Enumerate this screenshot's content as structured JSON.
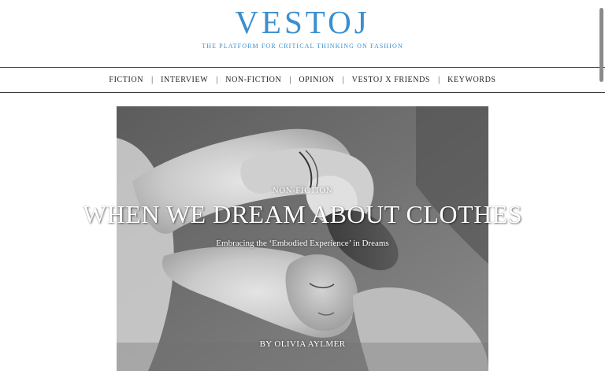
{
  "header": {
    "logo": "VESTOJ",
    "tagline": "THE PLATFORM FOR CRITICAL THINKING ON FASHION"
  },
  "nav": {
    "items": [
      {
        "label": "FICTION"
      },
      {
        "label": "INTERVIEW"
      },
      {
        "label": "NON-FICTION"
      },
      {
        "label": "OPINION"
      },
      {
        "label": "VESTOJ X FRIENDS"
      },
      {
        "label": "KEYWORDS"
      }
    ],
    "separator": "|"
  },
  "hero": {
    "kicker": "NON-FICTION",
    "title": "WHEN WE DREAM ABOUT CLOTHES",
    "subtitle": "Embracing the ‘Embodied Experience’ in Dreams",
    "byline": "BY OLIVIA AYLMER",
    "image": "black-and-white photograph of a sleeping woman with arms folded over her head"
  },
  "colors": {
    "brand": "#3a8fcf",
    "rule": "#3a3a3a",
    "nav_text": "#222222",
    "overlay_text": "#ffffff"
  }
}
